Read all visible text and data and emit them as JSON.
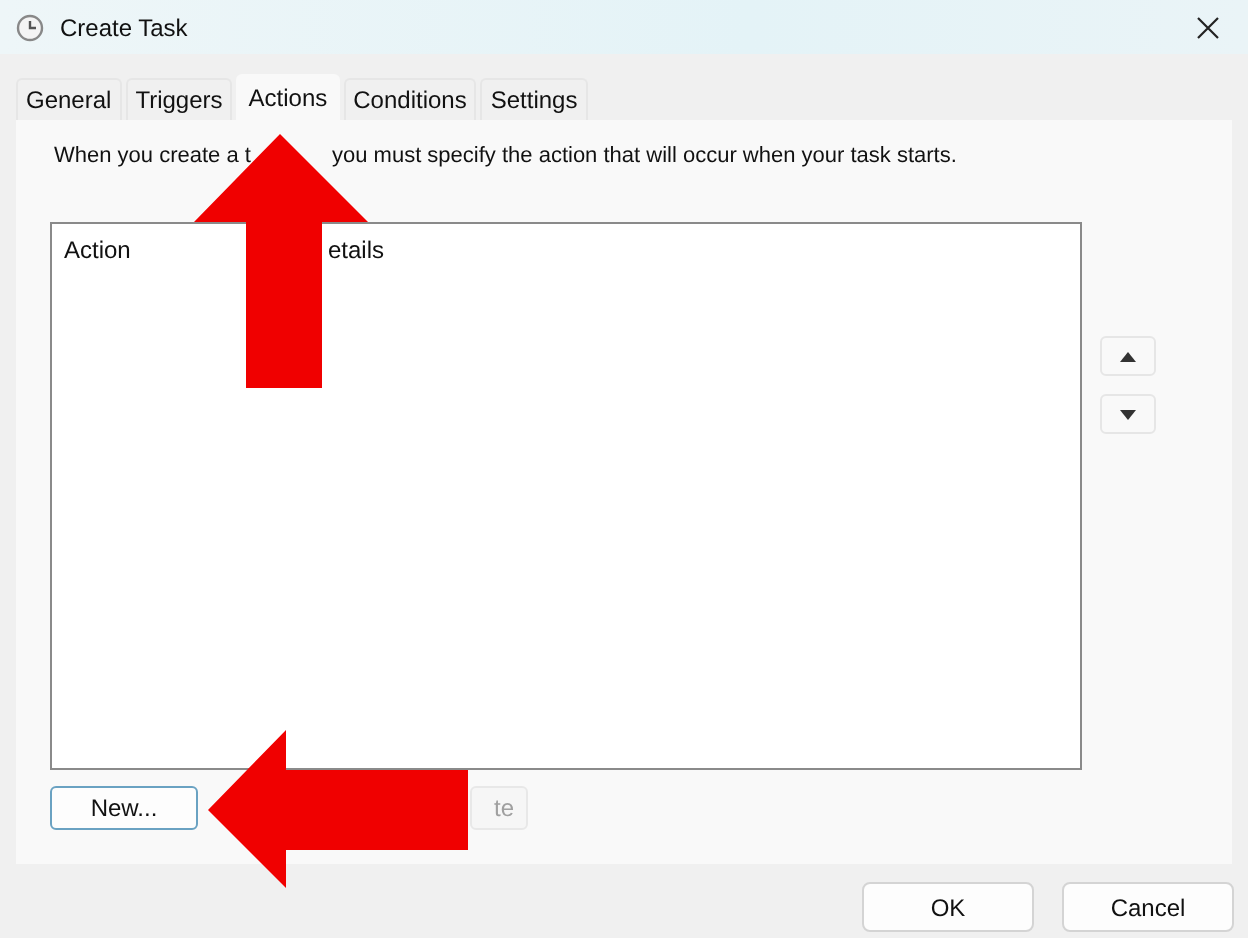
{
  "window": {
    "title": "Create Task"
  },
  "tabs": [
    {
      "label": "General",
      "selected": false
    },
    {
      "label": "Triggers",
      "selected": false
    },
    {
      "label": "Actions",
      "selected": true
    },
    {
      "label": "Conditions",
      "selected": false
    },
    {
      "label": "Settings",
      "selected": false
    }
  ],
  "description": {
    "before_arrow": "When you create a t",
    "after_arrow": "you must specify the action that will occur when your task starts."
  },
  "list": {
    "columns": [
      "Action",
      "etails"
    ]
  },
  "list_buttons": [
    {
      "label": "New...",
      "disabled": false
    },
    {
      "label": "te",
      "disabled": true
    }
  ],
  "dialog_buttons": [
    "OK",
    "Cancel"
  ]
}
